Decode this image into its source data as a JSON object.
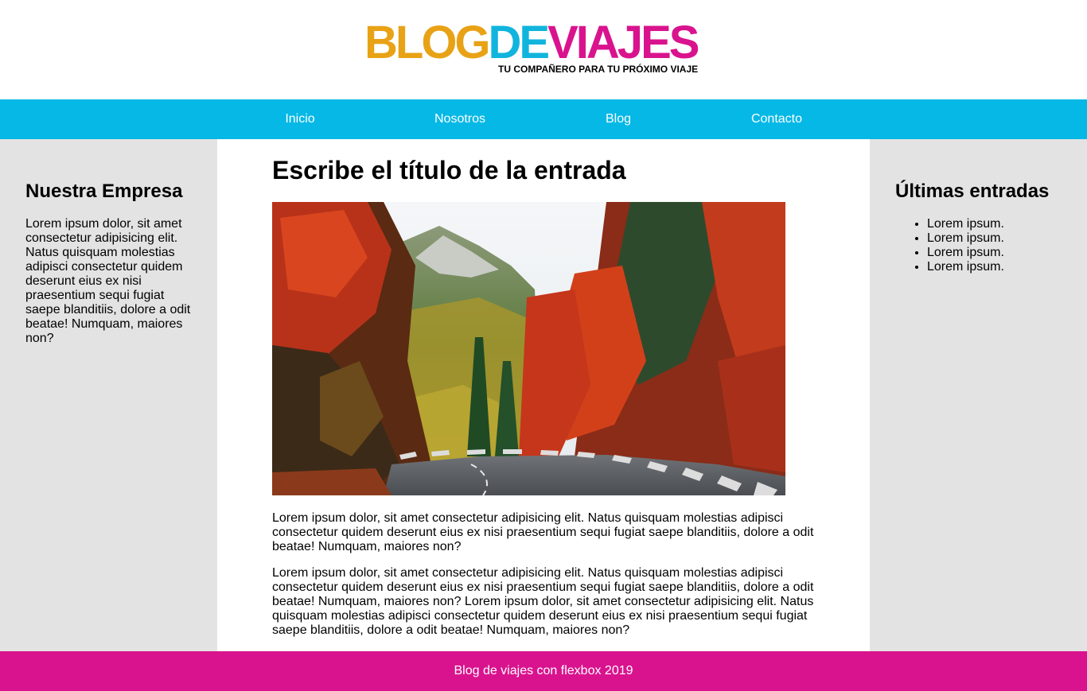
{
  "header": {
    "logo": {
      "part1": "BLOG",
      "part2": "DE",
      "part3": "VIAJES",
      "tagline": "TU COMPAÑERO PARA TU PRÓXIMO VIAJE"
    }
  },
  "nav": {
    "items": [
      {
        "label": "Inicio"
      },
      {
        "label": "Nosotros"
      },
      {
        "label": "Blog"
      },
      {
        "label": "Contacto"
      }
    ]
  },
  "sidebar_left": {
    "title": "Nuestra Empresa",
    "text": "Lorem ipsum dolor, sit amet consectetur adipisicing elit. Natus quisquam molestias adipisci consectetur quidem deserunt eius ex nisi praesentium sequi fugiat saepe blanditiis, dolore a odit beatae! Numquam, maiores non?"
  },
  "main": {
    "title": "Escribe el título de la entrada",
    "paragraphs": [
      "Lorem ipsum dolor, sit amet consectetur adipisicing elit. Natus quisquam molestias adipisci consectetur quidem deserunt eius ex nisi praesentium sequi fugiat saepe blanditiis, dolore a odit beatae! Numquam, maiores non?",
      "Lorem ipsum dolor, sit amet consectetur adipisicing elit. Natus quisquam molestias adipisci consectetur quidem deserunt eius ex nisi praesentium sequi fugiat saepe blanditiis, dolore a odit beatae! Numquam, maiores non? Lorem ipsum dolor, sit amet consectetur adipisicing elit. Natus quisquam molestias adipisci consectetur quidem deserunt eius ex nisi praesentium sequi fugiat saepe blanditiis, dolore a odit beatae! Numquam, maiores non?"
    ]
  },
  "sidebar_right": {
    "title": "Últimas entradas",
    "entries": [
      "Lorem ipsum.",
      "Lorem ipsum.",
      "Lorem ipsum.",
      "Lorem ipsum."
    ]
  },
  "footer": {
    "text": "Blog de viajes con flexbox 2019"
  },
  "colors": {
    "nav": "#05b8e6",
    "footer": "#d9138e",
    "sidebar": "#e3e3e3",
    "logo_orange": "#e8a215",
    "logo_blue": "#10b4dd",
    "logo_magenta": "#d9138e"
  }
}
